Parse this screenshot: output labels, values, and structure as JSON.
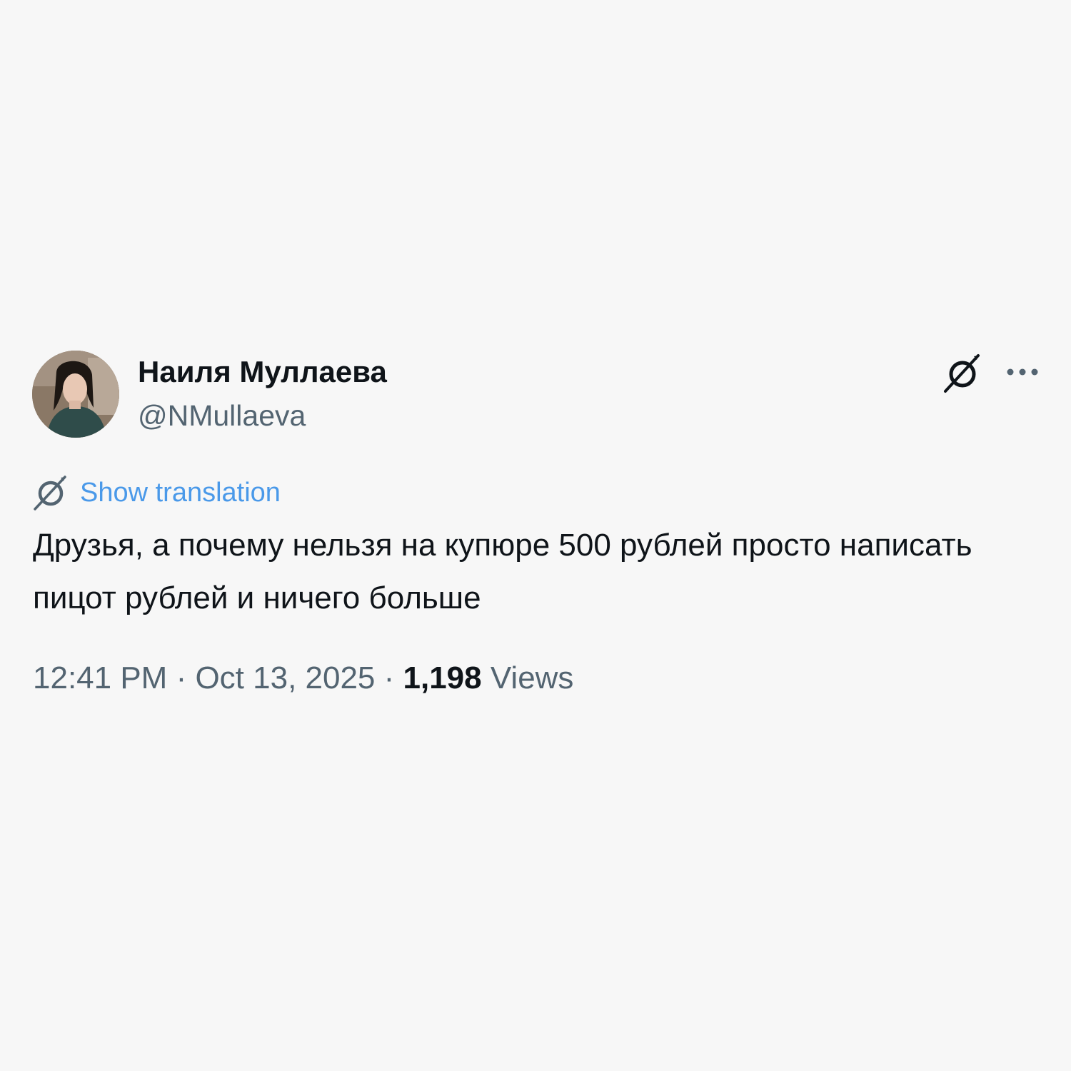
{
  "author": {
    "display_name": "Наиля Муллаева",
    "handle": "@NMullaeva",
    "avatar_icon": "profile-photo"
  },
  "actions": {
    "grok_icon": "grok-icon",
    "more_icon": "more-horizontal-icon"
  },
  "translation": {
    "icon": "grok-icon",
    "label": "Show translation"
  },
  "tweet": {
    "text": "Друзья, а почему нельзя на купюре 500 рублей просто написать пицот рублей и ничего больше"
  },
  "meta": {
    "time": "12:41 PM",
    "separator": " · ",
    "date": "Oct 13, 2025",
    "views_count": "1,198",
    "views_label": "Views"
  },
  "colors": {
    "background": "#f7f7f7",
    "text_primary": "#0f1419",
    "text_secondary": "#536471",
    "link": "#4a99e9"
  }
}
